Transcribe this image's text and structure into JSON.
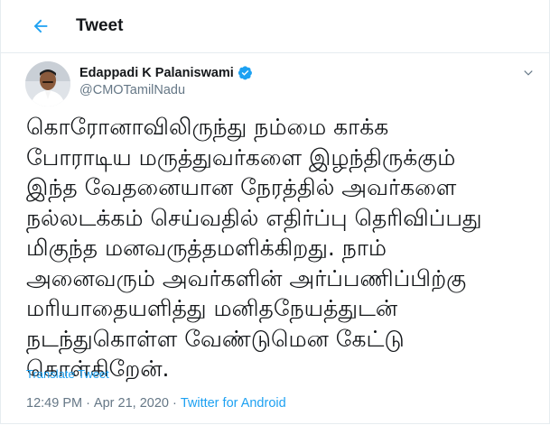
{
  "header": {
    "title": "Tweet"
  },
  "author": {
    "display_name": "Edappadi K Palaniswami",
    "handle": "@CMOTamilNadu",
    "verified": true
  },
  "tweet": {
    "lines": [
      "கொரோனாவிலிருந்து நம்மை காக்க",
      "போராடிய மருத்துவர்களை இழந்திருக்கும்",
      "இந்த வேதனையான நேரத்தில் அவர்களை",
      "நல்லடக்கம் செய்வதில் எதிர்ப்பு தெரிவிப்பது",
      "மிகுந்த மனவருத்தமளிக்கிறது. நாம்",
      "அனைவரும் அவர்களின் அர்ப்பணிப்பிற்கு",
      "மரியாதையளித்து மனிதநேயத்துடன்",
      "நடந்துகொள்ள வேண்டுமென கேட்டு",
      "கொள்கிறேன்."
    ],
    "translate_label": "Translate Tweet",
    "time": "12:49 PM",
    "separator": "·",
    "date": "Apr 21, 2020",
    "source": "Twitter for Android"
  },
  "colors": {
    "accent": "#1da1f2",
    "text": "#14171a",
    "muted": "#657786"
  },
  "icons": {
    "back": "arrow-left-icon",
    "verified": "verified-badge-icon",
    "more": "chevron-down-icon"
  }
}
